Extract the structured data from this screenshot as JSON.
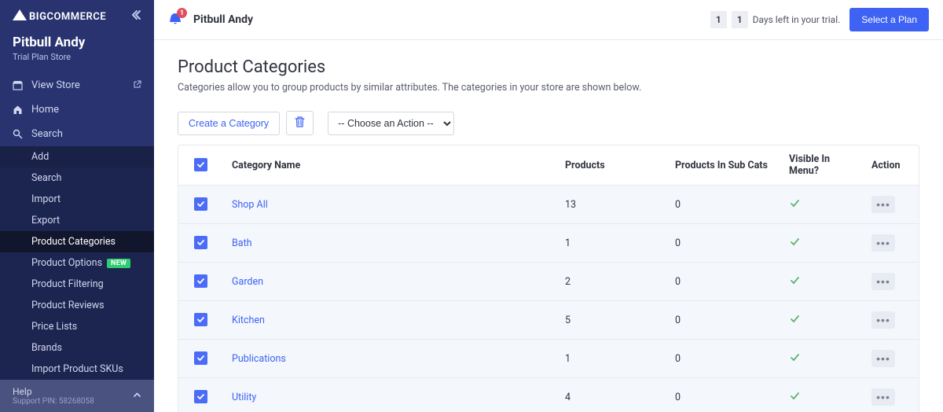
{
  "sidebar": {
    "logo_bold": "BIG",
    "logo_rest": "COMMERCE",
    "store_name": "Pitbull Andy",
    "store_plan": "Trial Plan Store",
    "nav": {
      "view_store": "View Store",
      "home": "Home",
      "search": "Search"
    },
    "products_sub": {
      "add": "Add",
      "search": "Search",
      "import": "Import",
      "export": "Export",
      "product_categories": "Product Categories",
      "product_options": "Product Options",
      "product_options_badge": "NEW",
      "product_filtering": "Product Filtering",
      "product_reviews": "Product Reviews",
      "price_lists": "Price Lists",
      "brands": "Brands",
      "import_skus": "Import Product SKUs"
    },
    "help": "Help",
    "support_pin": "Support PIN: 58268058"
  },
  "topbar": {
    "bell_count": "1",
    "title": "Pitbull Andy",
    "trial_digit_1": "1",
    "trial_digit_2": "1",
    "trial_text": "Days left in your trial.",
    "select_plan": "Select a Plan"
  },
  "page": {
    "title": "Product Categories",
    "description": "Categories allow you to group products by similar attributes. The categories in your store are shown below.",
    "create_btn": "Create a Category",
    "action_placeholder": "-- Choose an Action --"
  },
  "table": {
    "headers": {
      "category_name": "Category Name",
      "products": "Products",
      "sub_cats": "Products In Sub Cats",
      "visible": "Visible In Menu?",
      "action": "Action"
    },
    "rows": [
      {
        "name": "Shop All",
        "products": "13",
        "subcats": "0"
      },
      {
        "name": "Bath",
        "products": "1",
        "subcats": "0"
      },
      {
        "name": "Garden",
        "products": "2",
        "subcats": "0"
      },
      {
        "name": "Kitchen",
        "products": "5",
        "subcats": "0"
      },
      {
        "name": "Publications",
        "products": "1",
        "subcats": "0"
      },
      {
        "name": "Utility",
        "products": "4",
        "subcats": "0"
      }
    ]
  }
}
